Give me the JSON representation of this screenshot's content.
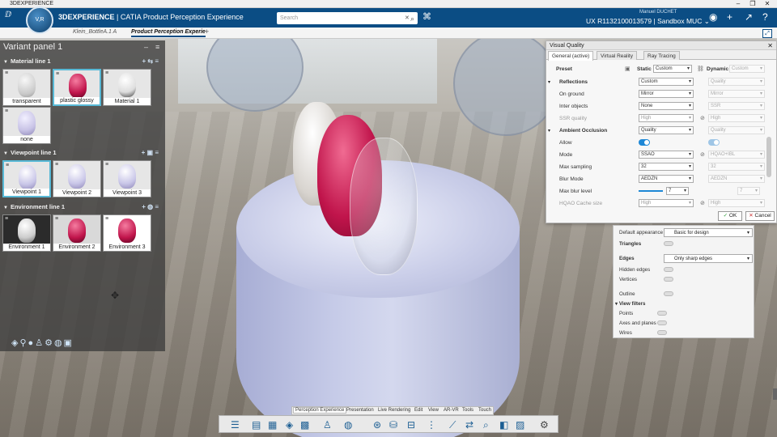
{
  "os": {
    "title": "3DEXPERIENCE"
  },
  "header": {
    "brand_bold": "3DEXPERIENCE",
    "brand_rest": " | CATIA  Product Perception Experience",
    "search_placeholder": "Search",
    "user_name": "Manuel DUCHET",
    "context": "UX R1132100013579 | Sandbox MUC ⌄",
    "compass_label": "V,R"
  },
  "tabs": [
    {
      "label": "Klein_BottleA.1 A"
    },
    {
      "label": "Product Perception Experie"
    },
    {
      "label": "+"
    }
  ],
  "variant_panel": {
    "title": "Variant panel 1",
    "sections": [
      {
        "title": "Material line 1",
        "items": [
          "transparent",
          "plastic glossy",
          "Material 1",
          "none"
        ]
      },
      {
        "title": "Viewpoint line 1",
        "items": [
          "Viewpoint 1",
          "Viewpoint 2",
          "Viewpoint 3"
        ]
      },
      {
        "title": "Environment line 1",
        "items": [
          "Environment 1",
          "Environment 2",
          "Environment 3"
        ]
      }
    ]
  },
  "visual_quality": {
    "title": "Visual Quality",
    "tabs": [
      "General (active)",
      "Virtual Reality",
      "Ray Tracing"
    ],
    "preset_label": "Preset",
    "static_label": "Static",
    "static_value": "Custom",
    "dynamic_label": "Dynamic",
    "dynamic_value": "Custom",
    "rows": [
      {
        "label": "Reflections",
        "header": true,
        "static": "Custom",
        "dynamic": "Quality"
      },
      {
        "label": "On ground",
        "static": "Mirror",
        "dynamic": "Mirror"
      },
      {
        "label": "Inter objects",
        "static": "None",
        "dynamic": "SSR"
      },
      {
        "label": "SSR quality",
        "static": "High",
        "dynamic": "High",
        "disabled": true
      },
      {
        "label": "Ambient Occlusion",
        "header": true,
        "static": "Quality",
        "dynamic": "Quality"
      },
      {
        "label": "Allow",
        "toggle": true
      },
      {
        "label": "Mode",
        "static": "SSAO",
        "dynamic": "HQAO+IBL"
      },
      {
        "label": "Max sampling",
        "static": "32",
        "dynamic": "32"
      },
      {
        "label": "Blur Mode",
        "static": "AEDZN",
        "dynamic": "AEDZN"
      },
      {
        "label": "Max blur level",
        "static": "7",
        "dynamic": "7"
      },
      {
        "label": "HQAO Cache size",
        "static": "High",
        "dynamic": "High",
        "disabled": true
      }
    ],
    "ok_label": "OK",
    "cancel_label": "Cancel"
  },
  "appearance": {
    "default_appearance_label": "Default appearance",
    "default_appearance_value": "Basic for design",
    "triangles_label": "Triangles",
    "edges_label": "Edges",
    "edges_value": "Only sharp edges",
    "hidden_edges_label": "Hidden edges",
    "vertices_label": "Vertices",
    "outline_label": "Outline",
    "view_filters_label": "View filters",
    "points_label": "Points",
    "axes_label": "Axes and planes",
    "wires_label": "Wires"
  },
  "bottom_tabs": [
    "Perception Experience",
    "Presentation",
    "Live Rendering",
    "Edit",
    "View",
    "AR-VR",
    "Tools",
    "Touch"
  ],
  "colors": {
    "brand": "#0b4d84",
    "selection": "#58b9d6",
    "pink": "#c0144b"
  }
}
